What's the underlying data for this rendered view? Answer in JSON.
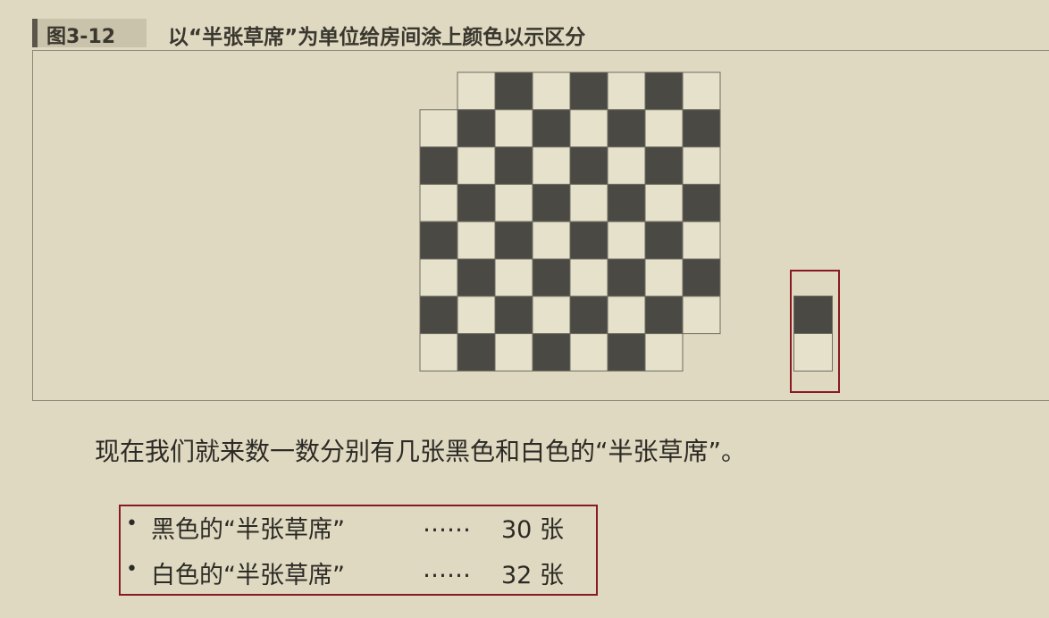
{
  "figure": {
    "number": "图3-12",
    "caption": "以“半张草席”为单位给房间涂上颜色以示区分"
  },
  "board": {
    "dark_color": "#4b4944",
    "light_color": "#e6e1cb",
    "line_color": "#6f6c62",
    "rows": [
      "_WBWBWBW",
      "WBWBWBWB",
      "BWBWBWBW",
      "WBWBWBWB",
      "BWBWBWBW",
      "WBWBWBWB",
      "BWBWBWBW",
      "WBWBWBW_"
    ]
  },
  "body_text": "现在我们就来数一数分别有几张黑色和白色的“半张草席”。",
  "results": [
    {
      "bullet": "•",
      "label": "黑色的“半张草席”",
      "dots": "……",
      "value": "30 张"
    },
    {
      "bullet": "•",
      "label": "白色的“半张草席”",
      "dots": "……",
      "value": "32 张"
    }
  ],
  "colors": {
    "highlight": "#8a1a22",
    "background": "#dfd9c1"
  }
}
